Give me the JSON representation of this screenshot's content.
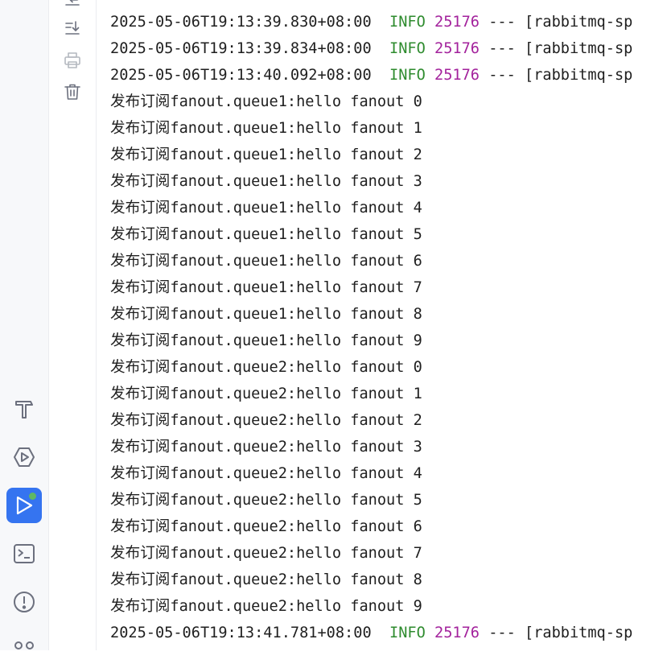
{
  "toolbar_icons": [
    "soft-wrap-icon",
    "scroll-to-end-icon",
    "print-icon",
    "clear-all-icon"
  ],
  "tool_window_icons": [
    "build-icon",
    "services-icon",
    "run-icon",
    "terminal-icon",
    "problems-icon",
    "version-control-icon"
  ],
  "colors": {
    "info": "#2e8b2e",
    "pid": "#a3229c",
    "run_active": "#3574f0",
    "status_dot": "#5fb865"
  },
  "console": {
    "log_top": [
      {
        "timestamp": "2025-05-06T19:13:39.830+08:00",
        "level": "INFO",
        "pid": "25176",
        "sep": "---",
        "thread": "[rabbitmq-sp"
      },
      {
        "timestamp": "2025-05-06T19:13:39.834+08:00",
        "level": "INFO",
        "pid": "25176",
        "sep": "---",
        "thread": "[rabbitmq-sp"
      },
      {
        "timestamp": "2025-05-06T19:13:40.092+08:00",
        "level": "INFO",
        "pid": "25176",
        "sep": "---",
        "thread": "[rabbitmq-sp"
      }
    ],
    "messages": [
      {
        "prefix": "发布订阅",
        "text": "fanout.queue1:hello fanout 0"
      },
      {
        "prefix": "发布订阅",
        "text": "fanout.queue1:hello fanout 1"
      },
      {
        "prefix": "发布订阅",
        "text": "fanout.queue1:hello fanout 2"
      },
      {
        "prefix": "发布订阅",
        "text": "fanout.queue1:hello fanout 3"
      },
      {
        "prefix": "发布订阅",
        "text": "fanout.queue1:hello fanout 4"
      },
      {
        "prefix": "发布订阅",
        "text": "fanout.queue1:hello fanout 5"
      },
      {
        "prefix": "发布订阅",
        "text": "fanout.queue1:hello fanout 6"
      },
      {
        "prefix": "发布订阅",
        "text": "fanout.queue1:hello fanout 7"
      },
      {
        "prefix": "发布订阅",
        "text": "fanout.queue1:hello fanout 8"
      },
      {
        "prefix": "发布订阅",
        "text": "fanout.queue1:hello fanout 9"
      },
      {
        "prefix": "发布订阅",
        "text": "fanout.queue2:hello fanout 0"
      },
      {
        "prefix": "发布订阅",
        "text": "fanout.queue2:hello fanout 1"
      },
      {
        "prefix": "发布订阅",
        "text": "fanout.queue2:hello fanout 2"
      },
      {
        "prefix": "发布订阅",
        "text": "fanout.queue2:hello fanout 3"
      },
      {
        "prefix": "发布订阅",
        "text": "fanout.queue2:hello fanout 4"
      },
      {
        "prefix": "发布订阅",
        "text": "fanout.queue2:hello fanout 5"
      },
      {
        "prefix": "发布订阅",
        "text": "fanout.queue2:hello fanout 6"
      },
      {
        "prefix": "发布订阅",
        "text": "fanout.queue2:hello fanout 7"
      },
      {
        "prefix": "发布订阅",
        "text": "fanout.queue2:hello fanout 8"
      },
      {
        "prefix": "发布订阅",
        "text": "fanout.queue2:hello fanout 9"
      }
    ],
    "log_bottom": [
      {
        "timestamp": "2025-05-06T19:13:41.781+08:00",
        "level": "INFO",
        "pid": "25176",
        "sep": "---",
        "thread": "[rabbitmq-sp"
      }
    ]
  }
}
